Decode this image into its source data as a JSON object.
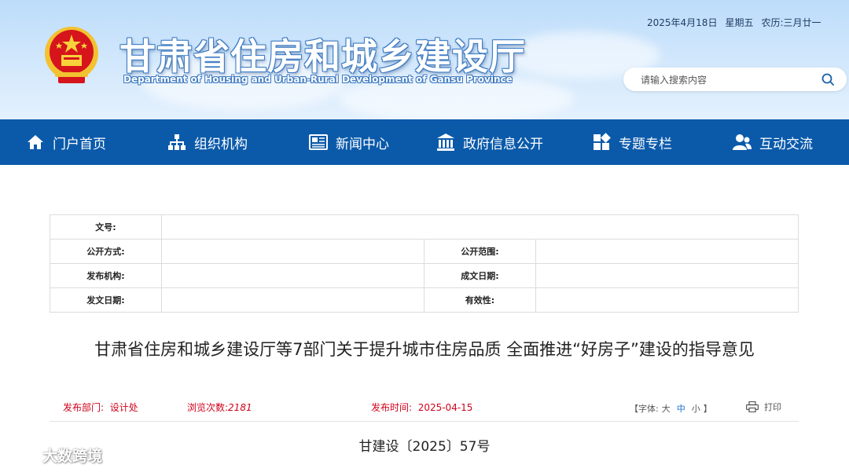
{
  "header": {
    "site_title": "甘肃省住房和城乡建设厅",
    "site_subtitle": "Department of Housing and Urban-Rural Development of Gansu Province",
    "date": "2025年4月18日",
    "weekday": "星期五",
    "lunar": "农历:三月廿一",
    "search_placeholder": "请输入搜索内容"
  },
  "nav": {
    "items": [
      {
        "label": "门户首页",
        "icon": "home-icon"
      },
      {
        "label": "组织机构",
        "icon": "org-chart-icon"
      },
      {
        "label": "新闻中心",
        "icon": "newspaper-icon"
      },
      {
        "label": "政府信息公开",
        "icon": "government-building-icon"
      },
      {
        "label": "专题专栏",
        "icon": "grid-icon"
      },
      {
        "label": "互动交流",
        "icon": "users-icon"
      }
    ]
  },
  "info_table": {
    "doc_no_label": "文号:",
    "doc_no_value": "",
    "public_method_label": "公开方式:",
    "public_method_value": "",
    "public_scope_label": "公开范围:",
    "public_scope_value": "",
    "issuer_label": "发布机构:",
    "issuer_value": "",
    "written_date_label": "成文日期:",
    "written_date_value": "",
    "issue_date_label": "发文日期:",
    "issue_date_value": "",
    "validity_label": "有效性:",
    "validity_value": ""
  },
  "article": {
    "title": "甘肃省住房和城乡建设厅等7部门关于提升城市住房品质 全面推进“好房子”建设的指导意见",
    "department_label": "发布部门:",
    "department_value": "设计处",
    "views_label": "浏览次数:",
    "views_value": "2181",
    "publish_time_label": "发布时间:",
    "publish_time_value": "2025-04-15",
    "font_size_label": "字体:",
    "font_size_large": "大",
    "font_size_medium": "中",
    "font_size_small": "小",
    "bracket_open": "【",
    "bracket_close": "】",
    "print_label": "打印",
    "doc_number": "甘建设〔2025〕57号"
  },
  "watermark": {
    "text": "大数跨境"
  },
  "colors": {
    "nav_bg": "#0b5aaa",
    "meta_red": "#d0021b",
    "active_blue": "#1a6fd1"
  }
}
